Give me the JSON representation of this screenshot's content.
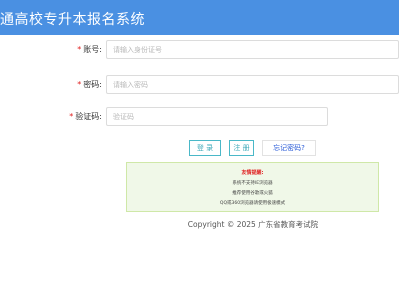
{
  "header": {
    "title": "通高校专升本报名系统"
  },
  "form": {
    "account": {
      "label": "账号:",
      "placeholder": "请输入身份证号"
    },
    "password": {
      "label": "密码:",
      "placeholder": "请输入密码"
    },
    "captcha": {
      "label": "验证码:",
      "placeholder": "验证码"
    }
  },
  "buttons": {
    "login": "登 录",
    "register": "注 册",
    "forgot": "忘记密码?"
  },
  "notice": {
    "title": "友情提醒:",
    "lines": [
      "系统不支持IE浏览器",
      "推荐使用谷歌或火狐",
      "QQ或360浏览器请使用极速模式"
    ]
  },
  "footer": {
    "copyright": "Copyright © 2025 广东省教育考试院"
  }
}
